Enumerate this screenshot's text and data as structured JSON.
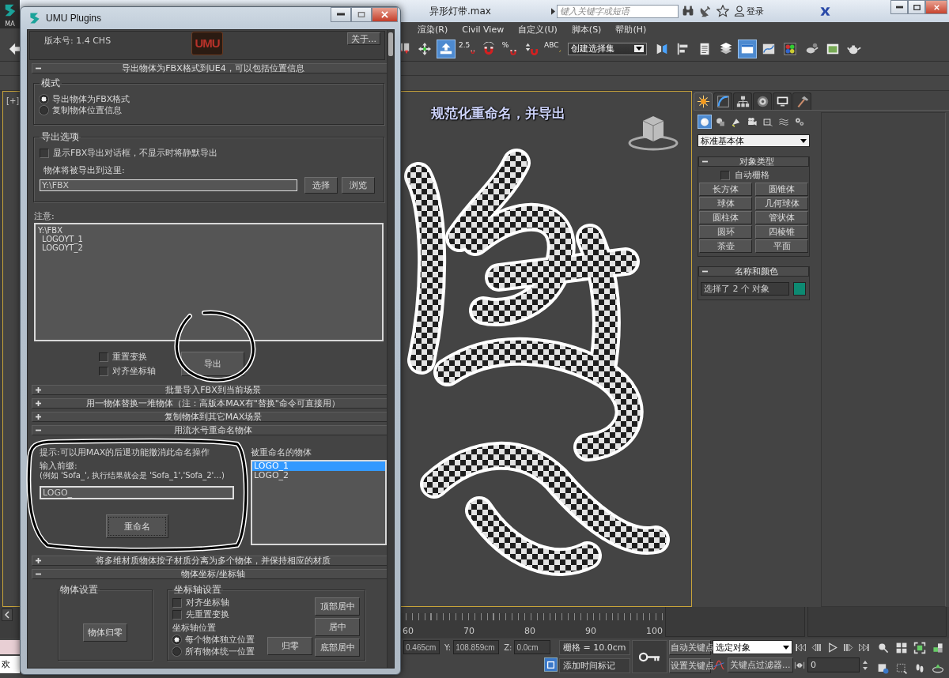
{
  "app": {
    "logo_text": "MA",
    "file_title": "异形灯带.max",
    "search_placeholder": "键入关键字或短语",
    "tools": [
      {
        "kind": "binoculars"
      },
      {
        "kind": "satellite"
      },
      {
        "kind": "star"
      }
    ],
    "sign_in": "登录"
  },
  "menu": [
    {
      "label": "渲染(R)"
    },
    {
      "label": "Civil View"
    },
    {
      "label": "自定义(U)"
    },
    {
      "label": "脚本(S)"
    },
    {
      "label": "帮助(H)"
    }
  ],
  "toolbar": {
    "left": [
      {
        "kind": "undo",
        "selected": false
      }
    ],
    "tools": [
      {
        "kind": "keys",
        "selected": false
      },
      {
        "kind": "move",
        "selected": false
      },
      {
        "kind": "place",
        "selected": true
      },
      {
        "kind": "snap",
        "label": "2.5",
        "selected": false
      },
      {
        "kind": "angle_snap",
        "selected": false
      },
      {
        "kind": "percent_snap",
        "label": "%",
        "selected": false
      },
      {
        "kind": "spinner_snap",
        "selected": false
      },
      {
        "kind": "named_sel",
        "label": "ABC",
        "selected": false
      }
    ],
    "selection_set": "创建选择集",
    "tools2": [
      {
        "kind": "mirror",
        "selected": false
      },
      {
        "kind": "align",
        "selected": false
      },
      {
        "kind": "explorer",
        "selected": false
      },
      {
        "kind": "layers",
        "selected": false
      },
      {
        "kind": "ribbon",
        "selected": true
      },
      {
        "kind": "curve_editor",
        "selected": false
      },
      {
        "kind": "material",
        "selected": false
      },
      {
        "kind": "render_setup",
        "selected": false
      },
      {
        "kind": "render_frame",
        "selected": false
      },
      {
        "kind": "render",
        "selected": false
      }
    ]
  },
  "viewport": {
    "label": "[+]",
    "caption": "规范化重命名，并导出"
  },
  "command_panel": {
    "tabs": [
      {
        "kind": "create",
        "selected": true
      },
      {
        "kind": "modify",
        "selected": false
      },
      {
        "kind": "hierarchy",
        "selected": false
      },
      {
        "kind": "motion",
        "selected": false
      },
      {
        "kind": "display",
        "selected": false
      },
      {
        "kind": "utilities",
        "selected": false
      }
    ],
    "categories": [
      {
        "kind": "geometry",
        "selected": true
      },
      {
        "kind": "shapes",
        "selected": false
      },
      {
        "kind": "lights",
        "selected": false
      },
      {
        "kind": "cameras",
        "selected": false
      },
      {
        "kind": "helpers",
        "selected": false
      },
      {
        "kind": "space_warps",
        "selected": false
      },
      {
        "kind": "systems",
        "selected": false
      }
    ],
    "object_class": "标准基本体",
    "rollouts": [
      {
        "kind": "object_type",
        "title": "对象类型",
        "expanded": true,
        "autogrid": {
          "label": "自动栅格",
          "checked": false
        },
        "buttons": [
          "长方体",
          "圆锥体",
          "球体",
          "几何球体",
          "圆柱体",
          "管状体",
          "圆环",
          "四棱锥",
          "茶壶",
          "平面"
        ]
      },
      {
        "kind": "name_color",
        "title": "名称和颜色",
        "expanded": true,
        "name": "选择了 2 个 对象",
        "color": "#0d8a72"
      }
    ]
  },
  "timeline": {
    "ticks": [
      "60",
      "70",
      "80",
      "90",
      "100"
    ]
  },
  "status": {
    "prompt": "欢",
    "x": "0.465cm",
    "y_label": "Y:",
    "y": "108.859cm",
    "z_label": "Z:",
    "z": "0.0cm",
    "grid": "栅格 = 10.0cm",
    "time_tag": "添加时间标记",
    "auto_key": "自动关键点",
    "set_key": "设置关键点",
    "key_mode": "选定对象",
    "key_filters": "关键点过滤器...",
    "frame": "0"
  },
  "plugin": {
    "title": "UMU Plugins",
    "version": "版本号: 1.4 CHS",
    "logo": "UMU",
    "about": "关于...",
    "rollouts": [
      {
        "kind": "export_fbx",
        "title": "导出物体为FBX格式到UE4，可以包括位置信息",
        "expanded": true,
        "mode": {
          "title": "模式",
          "options": [
            {
              "label": "导出物体为FBX格式",
              "selected": true
            },
            {
              "label": "复制物体位置信息",
              "selected": false
            }
          ]
        },
        "options": {
          "title": "导出选项",
          "show_dialog": {
            "label": "显示FBX导出对话框，不显示时将静默导出",
            "checked": false
          },
          "path_label": "物体将被导出到这里:",
          "path": "Y:\\FBX",
          "buttons": [
            "选择",
            "浏览"
          ]
        },
        "notes_label": "注意:",
        "log": [
          {
            "text": "Y:\\FBX",
            "children": [
              {
                "text": "LOGOYT_1"
              },
              {
                "text": "LOGOYT_2"
              }
            ]
          }
        ],
        "checks": [
          {
            "label": "重置变换",
            "checked": false
          },
          {
            "label": "对齐坐标轴",
            "checked": false
          }
        ],
        "export_button": "导出"
      },
      {
        "title": "批量导入FBX到当前场景",
        "expanded": false
      },
      {
        "title": "用一物体替换一堆物体（注：高版本MAX有\"替换\"命令可直接用）",
        "expanded": false
      },
      {
        "title": "复制物体到其它MAX场景",
        "expanded": false
      },
      {
        "kind": "rename",
        "title": "用流水号重命名物体",
        "expanded": true,
        "hint": "提示:可以用MAX的后退功能撤消此命名操作",
        "prefix_label": "输入前缀:",
        "example": "(例如 'Sofa_', 执行结果就会是 'Sofa_1','Sofa_2'...)",
        "prefix": "LOGO_",
        "button": "重命名",
        "list_label": "被重命名的物体",
        "items": [
          {
            "text": "LOGO_1",
            "selected": true
          },
          {
            "text": "LOGO_2",
            "selected": false
          }
        ]
      },
      {
        "title": "将多维材质物体按子材质分离为多个物体，并保持相应的材质",
        "expanded": false
      },
      {
        "kind": "pivot",
        "title": "物体坐标/坐标轴",
        "expanded": true,
        "object_group": {
          "title": "物体设置",
          "button": "物体归零"
        },
        "pivot_group": {
          "title": "坐标轴设置",
          "checks": [
            {
              "label": "对齐坐标轴",
              "checked": false
            },
            {
              "label": "先重置变换",
              "checked": false
            }
          ],
          "position_label": "坐标轴位置",
          "positions": [
            {
              "label": "每个物体独立位置",
              "selected": true
            },
            {
              "label": "所有物体统一位置",
              "selected": false
            }
          ],
          "zero_button": "归零",
          "buttons": [
            "顶部居中",
            "居中",
            "底部居中"
          ]
        }
      }
    ]
  }
}
